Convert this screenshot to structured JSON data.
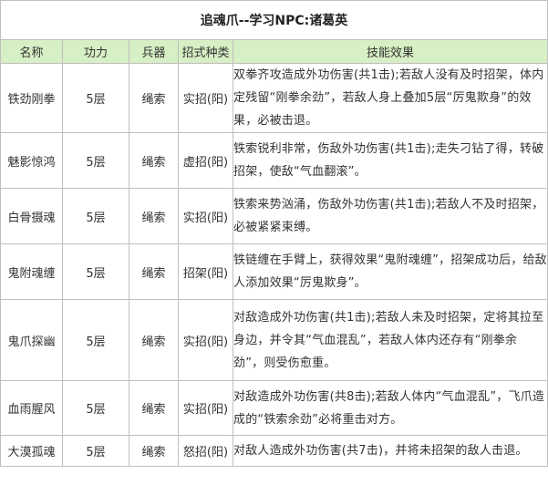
{
  "title": "追魂爪--学习NPC:诸葛英",
  "headers": [
    "名称",
    "功力",
    "兵器",
    "招式种类",
    "技能效果"
  ],
  "rows": [
    {
      "name": "铁劲刚拳",
      "level": "5层",
      "weapon": "绳索",
      "type": "实招(阳)",
      "effect": "双拳齐攻造成外功伤害(共1击);若敌人没有及时招架，体内定残留“刚拳余劲”，若敌人身上叠加5层“厉鬼欺身”的效果，必被击退。"
    },
    {
      "name": "魅影惊鸿",
      "level": "5层",
      "weapon": "绳索",
      "type": "虚招(阳)",
      "effect": "铁索锐利非常，伤敌外功伤害(共1击);走失刁钻了得，转破招架，使敌“气血翻滚”。"
    },
    {
      "name": "白骨摄魂",
      "level": "5层",
      "weapon": "绳索",
      "type": "实招(阳)",
      "effect": "铁索来势汹涌，伤敌外功伤害(共1击);若敌人不及时招架，必被紧紧束缚。"
    },
    {
      "name": "鬼附魂缠",
      "level": "5层",
      "weapon": "绳索",
      "type": "招架(阳)",
      "effect": "铁链缠在手臂上，获得效果“鬼附魂缠”，招架成功后，给敌人添加效果“厉鬼欺身”。"
    },
    {
      "name": "鬼爪探幽",
      "level": "5层",
      "weapon": "绳索",
      "type": "实招(阳)",
      "effect": "对敌造成外功伤害(共1击);若敌人未及时招架，定将其拉至身边，并令其“气血混乱”，若敌人体内还存有“刚拳余劲”，则受伤愈重。"
    },
    {
      "name": "血雨腥风",
      "level": "5层",
      "weapon": "绳索",
      "type": "实招(阳)",
      "effect": "对敌造成外功伤害(共8击);若敌人体内“气血混乱”，飞爪造成的“铁索余劲”必将重击对方。"
    },
    {
      "name": "大漠孤魂",
      "level": "5层",
      "weapon": "绳索",
      "type": "怒招(阳)",
      "effect": "对敌人造成外功伤害(共7击)，并将未招架的敌人击退。"
    }
  ]
}
